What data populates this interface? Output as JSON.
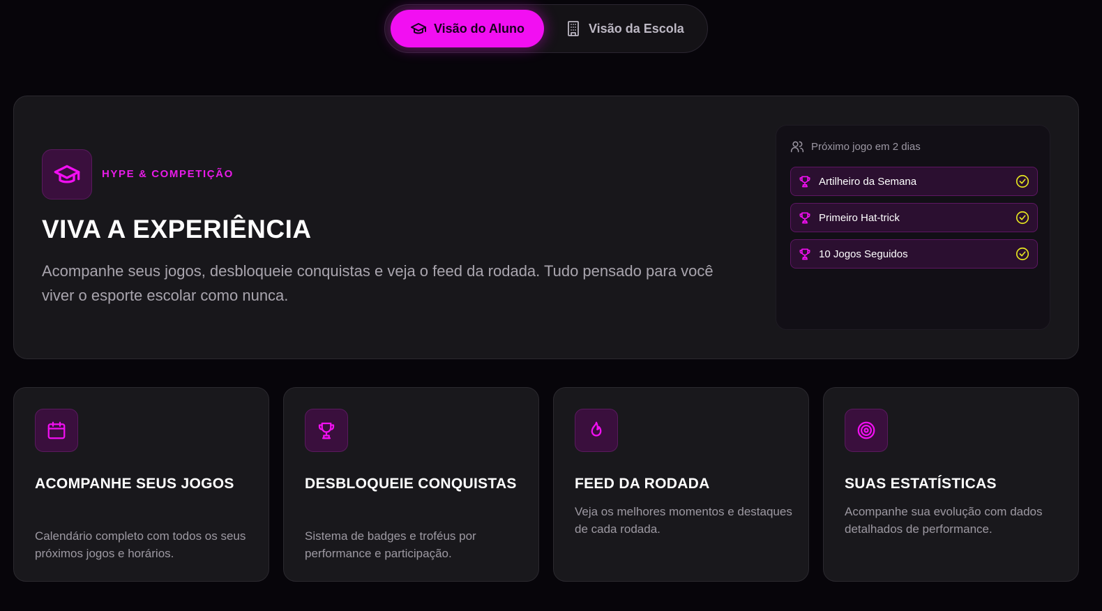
{
  "toggle": {
    "student_label": "Visão do Aluno",
    "school_label": "Visão da Escola"
  },
  "hero": {
    "eyebrow": "HYPE & COMPETIÇÃO",
    "title": "VIVA A EXPERIÊNCIA",
    "description": "Acompanhe seus jogos, desbloqueie conquistas e veja o feed da rodada. Tudo pensado para você viver o esporte escolar como nunca."
  },
  "panel": {
    "header": "Próximo jogo em 2 dias",
    "achievements": [
      {
        "label": "Artilheiro da Semana"
      },
      {
        "label": "Primeiro Hat-trick"
      },
      {
        "label": "10 Jogos Seguidos"
      }
    ]
  },
  "cards": [
    {
      "icon": "calendar-icon",
      "title": "ACOMPANHE SEUS JOGOS",
      "description": "Calendário completo com todos os seus próximos jogos e horários."
    },
    {
      "icon": "trophy-icon",
      "title": "DESBLOQUEIE CONQUISTAS",
      "description": "Sistema de badges e troféus por performance e participação."
    },
    {
      "icon": "flame-icon",
      "title": "FEED DA RODADA",
      "description": "Veja os melhores momentos e destaques de cada rodada."
    },
    {
      "icon": "target-icon",
      "title": "SUAS ESTATÍSTICAS",
      "description": "Acompanhe sua evolução com dados detalhados de performance."
    }
  ],
  "colors": {
    "accent": "#f20ff2",
    "background": "#07050a",
    "card": "#19181c",
    "check": "#e6e620"
  }
}
